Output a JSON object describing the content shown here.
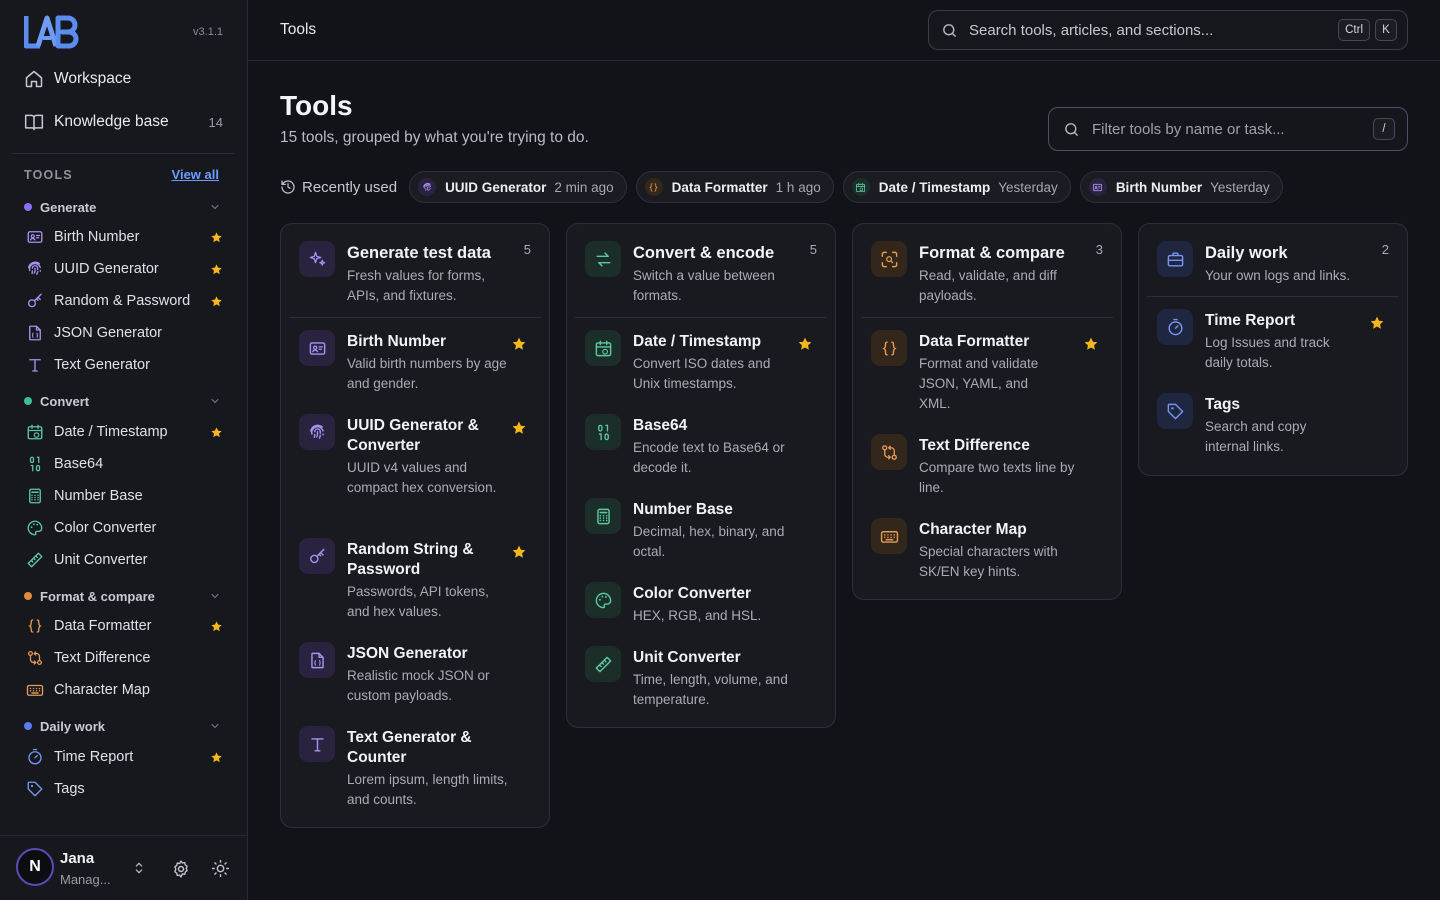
{
  "app": {
    "version": "v3.1.1",
    "nav": [
      {
        "label": "Workspace",
        "icon": "home-icon"
      },
      {
        "label": "Knowledge base",
        "icon": "book-icon",
        "count": "14"
      }
    ],
    "tools_heading": "TOOLS",
    "view_all": "View all"
  },
  "sidebar": {
    "groups": [
      {
        "label": "Generate",
        "color": "#8b6ff0",
        "items": [
          {
            "label": "Birth Number",
            "starred": true
          },
          {
            "label": "UUID Generator",
            "starred": true
          },
          {
            "label": "Random & Password",
            "starred": true
          },
          {
            "label": "JSON Generator",
            "starred": false
          },
          {
            "label": "Text Generator",
            "starred": false
          }
        ]
      },
      {
        "label": "Convert",
        "color": "#3fbf8f",
        "items": [
          {
            "label": "Date / Timestamp",
            "starred": true
          },
          {
            "label": "Base64",
            "starred": false
          },
          {
            "label": "Number Base",
            "starred": false
          },
          {
            "label": "Color Converter",
            "starred": false
          },
          {
            "label": "Unit Converter",
            "starred": false
          }
        ]
      },
      {
        "label": "Format & compare",
        "color": "#e38b3c",
        "items": [
          {
            "label": "Data Formatter",
            "starred": true
          },
          {
            "label": "Text Difference",
            "starred": false
          },
          {
            "label": "Character Map",
            "starred": false
          }
        ]
      },
      {
        "label": "Daily work",
        "color": "#5b7cf0",
        "items": [
          {
            "label": "Time Report",
            "starred": true
          },
          {
            "label": "Tags",
            "starred": false
          }
        ]
      }
    ]
  },
  "user": {
    "initial": "N",
    "name": "Jana",
    "role": "Manag..."
  },
  "topbar": {
    "breadcrumb": "Tools",
    "search_placeholder": "Search tools, articles, and sections...",
    "kbd1": "Ctrl",
    "kbd2": "K"
  },
  "page": {
    "title": "Tools",
    "subtitle": "15 tools, grouped by what you're trying to do.",
    "filter_placeholder": "Filter tools by name or task...",
    "filter_kbd": "/",
    "recent_label": "Recently used",
    "recent": [
      {
        "name": "UUID Generator",
        "time": "2 min ago"
      },
      {
        "name": "Data Formatter",
        "time": "1 h ago"
      },
      {
        "name": "Date / Timestamp",
        "time": "Yesterday"
      },
      {
        "name": "Birth Number",
        "time": "Yesterday"
      }
    ]
  },
  "cards": [
    {
      "title": "Generate test data",
      "desc": "Fresh values for forms, APIs, and fixtures.",
      "count": "5",
      "tools": [
        {
          "name": "Birth Number",
          "desc": "Valid birth numbers by age and gender.",
          "starred": true
        },
        {
          "name": "UUID Generator & Converter",
          "desc": "UUID v4 values and compact hex conversion.",
          "starred": true
        },
        {
          "name": "Random String & Password",
          "desc": "Passwords, API tokens, and hex values.",
          "starred": true
        },
        {
          "name": "JSON Generator",
          "desc": "Realistic mock JSON or custom payloads.",
          "starred": false
        },
        {
          "name": "Text Generator & Counter",
          "desc": "Lorem ipsum, length limits, and counts.",
          "starred": false
        }
      ]
    },
    {
      "title": "Convert & encode",
      "desc": "Switch a value between formats.",
      "count": "5",
      "tools": [
        {
          "name": "Date / Timestamp",
          "desc": "Convert ISO dates and Unix timestamps.",
          "starred": true
        },
        {
          "name": "Base64",
          "desc": "Encode text to Base64 or decode it.",
          "starred": false
        },
        {
          "name": "Number Base",
          "desc": "Decimal, hex, binary, and octal.",
          "starred": false
        },
        {
          "name": "Color Converter",
          "desc": "HEX, RGB, and HSL.",
          "starred": false
        },
        {
          "name": "Unit Converter",
          "desc": "Time, length, volume, and temperature.",
          "starred": false
        }
      ]
    },
    {
      "title": "Format & compare",
      "desc": "Read, validate, and diff payloads.",
      "count": "3",
      "tools": [
        {
          "name": "Data Formatter",
          "desc": "Format and validate JSON, YAML, and XML.",
          "starred": true
        },
        {
          "name": "Text Difference",
          "desc": "Compare two texts line by line.",
          "starred": false
        },
        {
          "name": "Character Map",
          "desc": "Special characters with SK/EN key hints.",
          "starred": false
        }
      ]
    },
    {
      "title": "Daily work",
      "desc": "Your own logs and links.",
      "count": "2",
      "tools": [
        {
          "name": "Time Report",
          "desc": "Log Issues and track daily totals.",
          "starred": true
        },
        {
          "name": "Tags",
          "desc": "Search and copy internal links.",
          "starred": false
        }
      ]
    }
  ]
}
